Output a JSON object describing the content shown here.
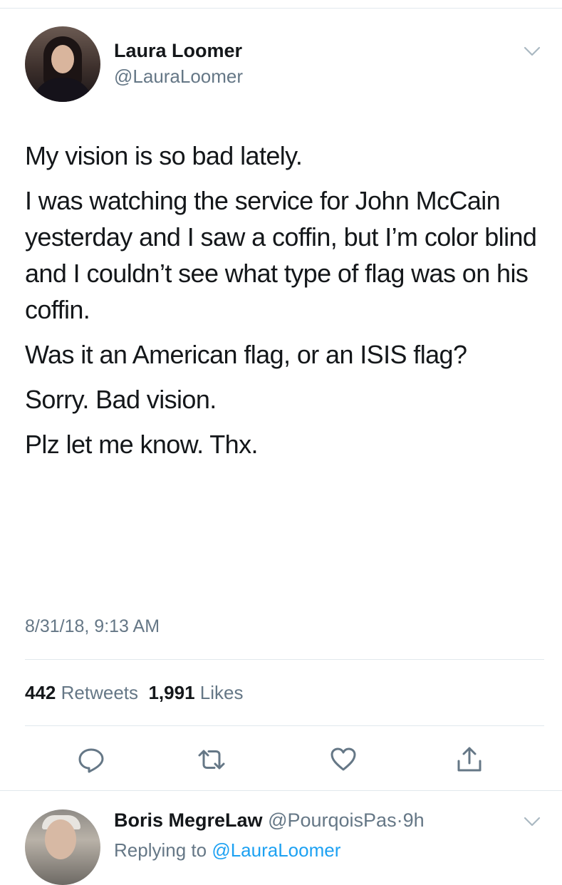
{
  "tweet": {
    "author_name": "Laura Loomer",
    "author_handle": "@LauraLoomer",
    "paragraphs": [
      "My vision is so bad lately.",
      "I was watching the service for John McCain yesterday and I saw a coffin, but I’m color blind and I couldn’t see what type of flag was on his coffin.",
      "Was it an American flag, or an ISIS flag?",
      "Sorry. Bad vision.",
      "Plz let me know. Thx."
    ],
    "timestamp": "8/31/18, 9:13 AM",
    "retweets_count": "442",
    "retweets_label": "Retweets",
    "likes_count": "1,991",
    "likes_label": "Likes"
  },
  "actions": {
    "reply_icon": "reply-icon",
    "retweet_icon": "retweet-icon",
    "like_icon": "heart-icon",
    "share_icon": "share-icon"
  },
  "reply": {
    "author_name": "Boris MegreLaw",
    "author_handle": "@PourqoisPas",
    "separator": "·",
    "time": "9h",
    "replying_label": "Replying to",
    "replying_to": "@LauraLoomer"
  },
  "colors": {
    "text": "#14171a",
    "secondary": "#657786",
    "accent": "#1da1f2",
    "divider": "#e1e8ed"
  }
}
